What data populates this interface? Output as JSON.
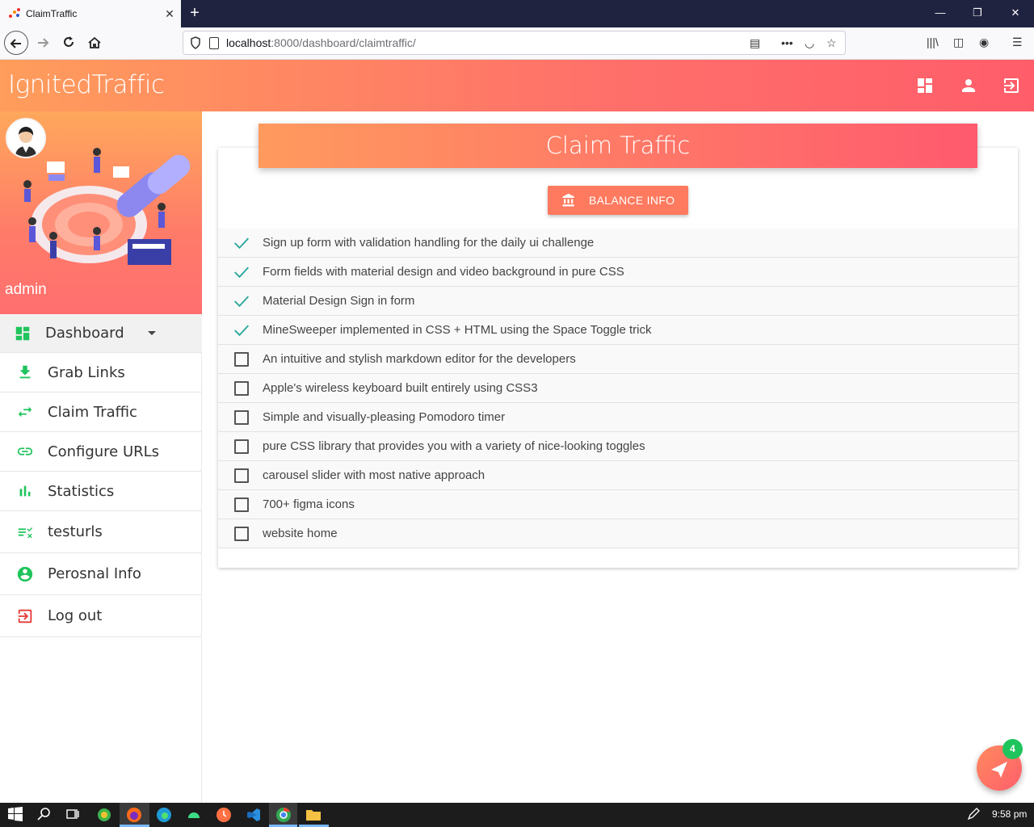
{
  "browser": {
    "tab_title": "ClaimTraffic",
    "url_host": "localhost",
    "url_path": ":8000/dashboard/claimtraffic/"
  },
  "app": {
    "brand": "IgnitedTraffic",
    "username": "admin"
  },
  "sidebar": {
    "items": [
      {
        "label": "Dashboard",
        "icon": "dashboard-icon"
      },
      {
        "label": "Grab Links",
        "icon": "download-icon"
      },
      {
        "label": "Claim Traffic",
        "icon": "swap-arrows-icon"
      },
      {
        "label": "Configure URLs",
        "icon": "link-icon"
      },
      {
        "label": "Statistics",
        "icon": "bar-chart-icon"
      },
      {
        "label": "testurls",
        "icon": "list-check-icon"
      },
      {
        "label": "Perosnal Info",
        "icon": "account-circle-icon"
      },
      {
        "label": "Log out",
        "icon": "logout-icon"
      }
    ]
  },
  "main": {
    "title": "Claim Traffic",
    "balance_button": "BALANCE INFO",
    "tasks": [
      {
        "label": "Sign up form with validation handling for the daily ui challenge",
        "done": true
      },
      {
        "label": "Form fields with material design and video background in pure CSS",
        "done": true
      },
      {
        "label": "Material Design Sign in form",
        "done": true
      },
      {
        "label": "MineSweeper implemented in CSS + HTML using the Space Toggle trick",
        "done": true
      },
      {
        "label": "An intuitive and stylish markdown editor for the developers",
        "done": false
      },
      {
        "label": "Apple's wireless keyboard built entirely using CSS3",
        "done": false
      },
      {
        "label": "Simple and visually-pleasing Pomodoro timer",
        "done": false
      },
      {
        "label": "pure CSS library that provides you with a variety of nice-looking toggles",
        "done": false
      },
      {
        "label": "carousel slider with most native approach",
        "done": false
      },
      {
        "label": "700+ figma icons",
        "done": false
      },
      {
        "label": "website home",
        "done": false
      }
    ]
  },
  "fab": {
    "badge": "4"
  },
  "taskbar": {
    "time": "9:58 pm"
  },
  "colors": {
    "accent": "#ff7a5f",
    "check": "#26a69a",
    "menu_icon": "#1fc45c",
    "logout_icon": "#e53935"
  }
}
